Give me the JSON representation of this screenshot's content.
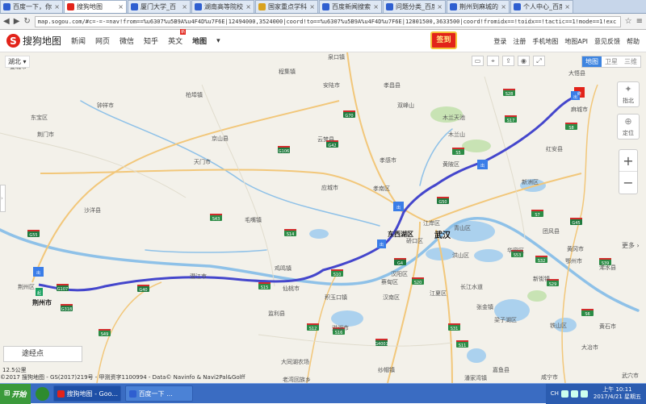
{
  "browser": {
    "tabs": [
      {
        "title": "百度一下，你"
      },
      {
        "title": "搜狗地图"
      },
      {
        "title": "厦门大学_百"
      },
      {
        "title": "湖南高等院校"
      },
      {
        "title": "国家重点学科"
      },
      {
        "title": "百度新闻搜索"
      },
      {
        "title": "问题分类_百度"
      },
      {
        "title": "荆州到麻城的"
      },
      {
        "title": "个人中心_百度"
      }
    ],
    "url": "map.sogou.com/#c=-=-=nav!from==%u6307%u5B9A%u4F4D%u7F6E|12494000,3524000|coord!to==%u6307%u5B9A%u4F4D%u7F6E|12801500,3633500|coord!fromidx==!toidx==!tactic==1!mode==1!exc"
  },
  "site": {
    "logo_text": "搜狗地图",
    "nav": [
      "新闻",
      "网页",
      "微信",
      "知乎",
      "英文",
      "地图"
    ],
    "new_badge": "新",
    "checkin": "签到",
    "links": [
      "登录",
      "注册",
      "手机地图",
      "地图API",
      "意见反馈",
      "帮助"
    ]
  },
  "map": {
    "region": "湖北",
    "maptype": [
      "地图",
      "卫星",
      "三维"
    ],
    "side_buttons": {
      "compass": "指北",
      "locate": "定位"
    },
    "zoom_in": "+",
    "zoom_out": "−",
    "more": "更多",
    "waypoint": "途经点",
    "scale": "12.5公里",
    "copyright": "©2017 搜狗地图 - GS(2017)219号 - 甲测资字1100994 - Data© Navinfo & Navi2Pal&Golff",
    "start_marker": "起",
    "end_marker": "终",
    "exit_marker": "出",
    "places": [
      {
        "name": "宜城市"
      },
      {
        "name": "东宝区"
      },
      {
        "name": "荆门市"
      },
      {
        "name": "钟祥市"
      },
      {
        "name": "京山县"
      },
      {
        "name": "沙洋县"
      },
      {
        "name": "潜江市"
      },
      {
        "name": "仙桃市"
      },
      {
        "name": "天门市"
      },
      {
        "name": "应城市"
      },
      {
        "name": "孝感市"
      },
      {
        "name": "孝南区"
      },
      {
        "name": "云梦县"
      },
      {
        "name": "安陆市"
      },
      {
        "name": "孝昌县"
      },
      {
        "name": "大悟县"
      },
      {
        "name": "黄陂区"
      },
      {
        "name": "东西湖区"
      },
      {
        "name": "硚口区"
      },
      {
        "name": "武汉"
      },
      {
        "name": "江岸区"
      },
      {
        "name": "青山区"
      },
      {
        "name": "洪山区"
      },
      {
        "name": "汉阳区"
      },
      {
        "name": "汉南区"
      },
      {
        "name": "江夏区"
      },
      {
        "name": "新洲区"
      },
      {
        "name": "麻城市"
      },
      {
        "name": "红安县"
      },
      {
        "name": "团风县"
      },
      {
        "name": "黄冈市"
      },
      {
        "name": "鄂州市"
      },
      {
        "name": "华容区"
      },
      {
        "name": "黄石市"
      },
      {
        "name": "梁子湖区"
      },
      {
        "name": "铁山区"
      },
      {
        "name": "荆州市"
      },
      {
        "name": "荆州区"
      },
      {
        "name": "监利县"
      },
      {
        "name": "洪湖市"
      },
      {
        "name": "嘉鱼县"
      },
      {
        "name": "咸宁市"
      },
      {
        "name": "蔡甸区"
      },
      {
        "name": "纱帽镇"
      },
      {
        "name": "浠水县"
      },
      {
        "name": "大冶市"
      },
      {
        "name": "武穴市"
      },
      {
        "name": "木兰天池"
      },
      {
        "name": "木兰山"
      },
      {
        "name": "双峰山"
      },
      {
        "name": "积玉口镇"
      },
      {
        "name": "毛嘴镇"
      },
      {
        "name": "鸡鸣镇"
      },
      {
        "name": "张金镇"
      },
      {
        "name": "新街镇"
      },
      {
        "name": "大同湖农场"
      },
      {
        "name": "老湾回族乡"
      },
      {
        "name": "潘家湾镇"
      },
      {
        "name": "长江水道"
      },
      {
        "name": "柏埠镇"
      },
      {
        "name": "程集镇"
      },
      {
        "name": "泉口镇"
      }
    ],
    "highways": [
      "G70",
      "G4",
      "G42",
      "G50",
      "G45",
      "G55",
      "G107",
      "G318",
      "G40",
      "G4001",
      "G106",
      "S43",
      "S49",
      "S53",
      "S7",
      "S8",
      "S10",
      "S11",
      "S12",
      "S14",
      "S15",
      "S16",
      "S20",
      "S17",
      "S39",
      "S32",
      "S31",
      "S6",
      "S29",
      "S5",
      "S28"
    ]
  },
  "taskbar": {
    "start": "开始",
    "tasks": [
      "搜狗地图 - Goo...",
      "百度一下 ..."
    ],
    "tray_lang": "CH",
    "time": "上午 10:11",
    "date": "2017/4/21 星期五"
  }
}
